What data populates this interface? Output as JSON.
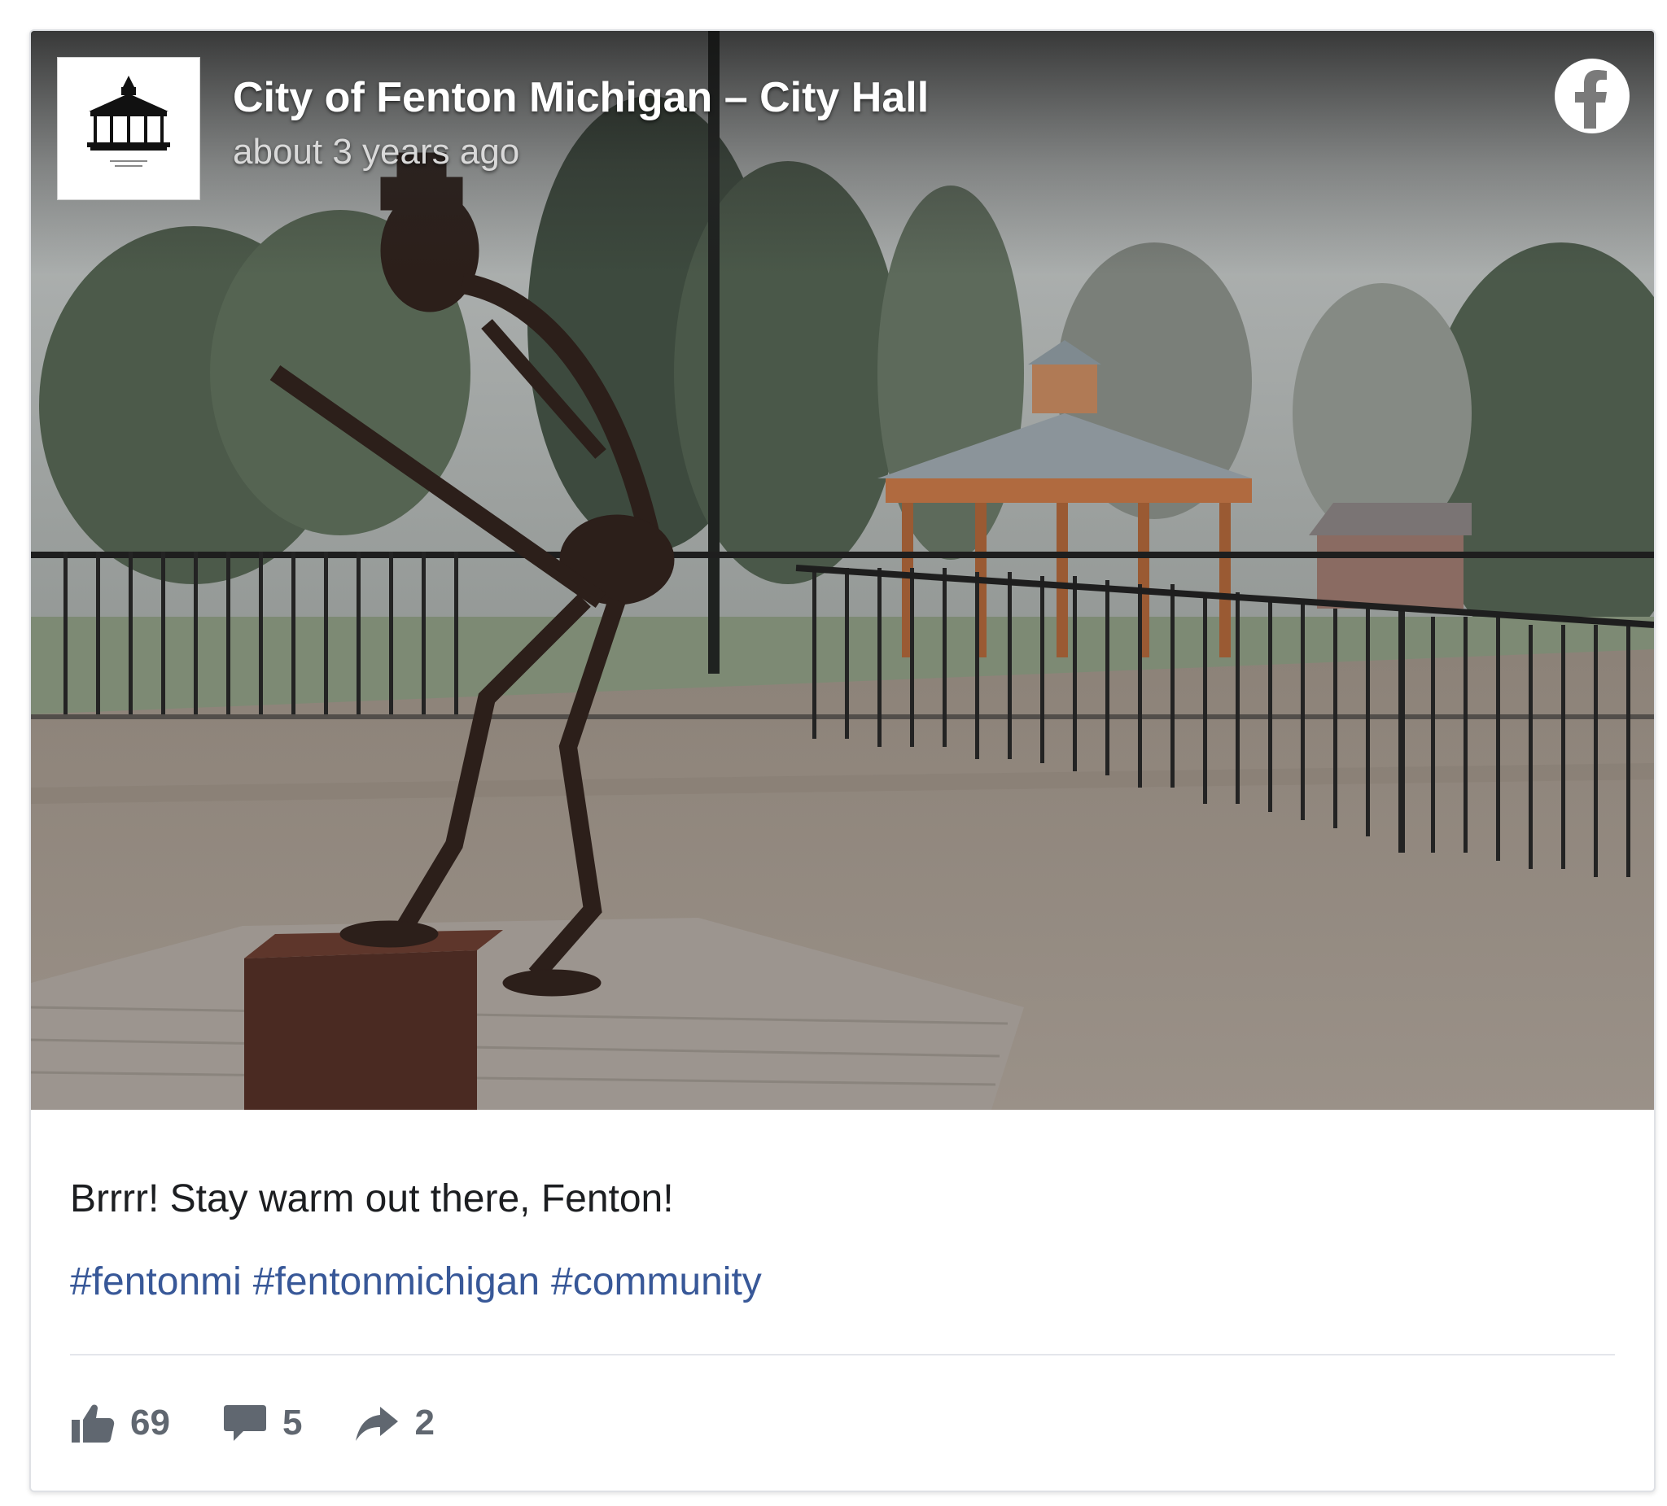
{
  "post": {
    "page_name": "City of Fenton Michigan – City Hall",
    "timestamp": "about 3 years ago",
    "text": "Brrrr! Stay warm out there, Fenton!",
    "hashtags": [
      "#fentonmi",
      "#fentonmichigan",
      "#community"
    ]
  },
  "icons": {
    "platform": "facebook-icon",
    "avatar": "gazebo-logo",
    "like": "thumbs-up-icon",
    "comment": "comment-icon",
    "share": "share-arrow-icon"
  },
  "stats": {
    "likes": "69",
    "comments": "5",
    "shares": "2"
  },
  "colors": {
    "link": "#385898",
    "text": "#1c1e21",
    "meta": "#606770",
    "border": "#dfe1e5"
  }
}
